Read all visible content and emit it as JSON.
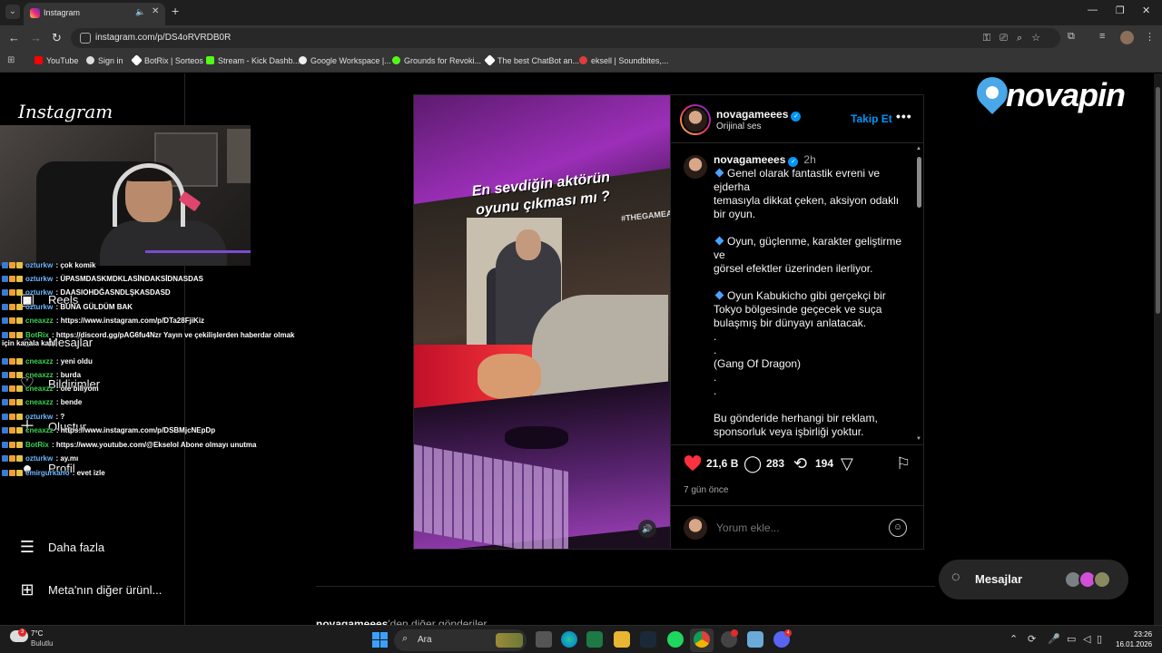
{
  "browser": {
    "tab": {
      "title": "Instagram"
    },
    "url": "instagram.com/p/DS4oRVRDB0R",
    "bookmarks": [
      "YouTube",
      "Sign in",
      "BotRix | Sorteos",
      "Stream - Kick Dashb...",
      "Google Workspace |...",
      "Grounds for Revoki...",
      "The best ChatBot an...",
      "eksell | Soundbites,..."
    ]
  },
  "sidebar": {
    "logo": "Instagram",
    "items": [
      {
        "label": "Reels",
        "icon": "reels-icon"
      },
      {
        "label": "Mesajlar",
        "icon": "messenger-icon"
      },
      {
        "label": "Bildirimler",
        "icon": "heart-icon"
      },
      {
        "label": "Oluştur",
        "icon": "plus-icon"
      },
      {
        "label": "Profil",
        "icon": "profile-icon"
      },
      {
        "label": "Daha fazla",
        "icon": "menu-icon"
      },
      {
        "label": "Meta'nın diğer ürünl...",
        "icon": "grid-icon"
      }
    ]
  },
  "stream_chat": [
    {
      "user": "ozturkw",
      "text": " : çok komik",
      "color": "#6fb7ff"
    },
    {
      "user": "ozturkw",
      "text": " : ÜPASMDASKMDKLASİNDAKSİDNASDAS",
      "color": "#6fb7ff"
    },
    {
      "user": "ozturkw",
      "text": " : DAASIOHDĞASNDLŞKASDASD",
      "color": "#6fb7ff"
    },
    {
      "user": "ozturkw",
      "text": " : BUNA GÜLDÜM BAK",
      "color": "#6fb7ff"
    },
    {
      "user": "cneaxzz",
      "text": " : https://www.instagram.com/p/DTa28FjiKiz",
      "color": "#39d353"
    },
    {
      "user": "BotRix",
      "text": " : https://discord.gg/pAG6fu4Nzr Yayın ve çekilişlerden haberdar olmak",
      "color": "#39d353"
    },
    {
      "user": "",
      "text": "için kanala katıl",
      "color": "#ffffff"
    },
    {
      "user": "cneaxzz",
      "text": " : yeni oldu",
      "color": "#39d353"
    },
    {
      "user": "cneaxzz",
      "text": " : burda",
      "color": "#39d353"
    },
    {
      "user": "cneaxzz",
      "text": " : öle biliyom",
      "color": "#39d353"
    },
    {
      "user": "cneaxzz",
      "text": " : bende",
      "color": "#39d353"
    },
    {
      "user": "ozturkw",
      "text": " : ?",
      "color": "#6fb7ff"
    },
    {
      "user": "cneaxzz",
      "text": " : https://www.instagram.com/p/DSBMjcNEpDp",
      "color": "#39d353"
    },
    {
      "user": "BotRix",
      "text": " : https://www.youtube.com/@Ekselol Abone olmayı unutma",
      "color": "#39d353"
    },
    {
      "user": "ozturkw",
      "text": " : ay.mı",
      "color": "#6fb7ff"
    },
    {
      "user": "emirgurkano",
      "text": " : evet izle",
      "color": "#6fb7ff"
    }
  ],
  "post": {
    "media": {
      "banner_line1": "En sevdiğin aktörün",
      "banner_line2": "oyunu çıkması mı ?",
      "hashtag": "#THEGAMEA"
    },
    "author": {
      "username": "novagameees",
      "subtitle": "Orijinal ses",
      "follow_label": "Takip Et"
    },
    "caption": {
      "username": "novagameees",
      "time": "2h",
      "lines": [
        {
          "text": "Genel olarak fantastik evreni ve",
          "bullet": true
        },
        {
          "text": "ejderha",
          "bullet": false
        },
        {
          "text": "temasıyla dikkat çeken, aksiyon odaklı",
          "bullet": false
        },
        {
          "text": "bir oyun.",
          "bullet": false
        },
        {
          "text": "",
          "bullet": false
        },
        {
          "text": "Oyun, güçlenme, karakter geliştirme",
          "bullet": true
        },
        {
          "text": "ve",
          "bullet": false
        },
        {
          "text": "görsel efektler üzerinden ilerliyor.",
          "bullet": false
        },
        {
          "text": "",
          "bullet": false
        },
        {
          "text": "Oyun Kabukicho gibi gerçekçi bir",
          "bullet": true
        },
        {
          "text": "Tokyo bölgesinde geçecek ve suça",
          "bullet": false
        },
        {
          "text": "bulaşmış bir dünyayı anlatacak.",
          "bullet": false
        },
        {
          "text": ".",
          "bullet": false
        },
        {
          "text": ".",
          "bullet": false
        },
        {
          "text": "(Gang Of Dragon)",
          "bullet": false
        },
        {
          "text": ".",
          "bullet": false
        },
        {
          "text": ".",
          "bullet": false
        },
        {
          "text": "",
          "bullet": false
        },
        {
          "text": "Bu gönderide herhangi bir reklam,",
          "bullet": false
        },
        {
          "text": "sponsorluk veya işbirliği yoktur.",
          "bullet": false
        }
      ]
    },
    "stats": {
      "likes": "21,6 B",
      "comments": "283",
      "reposts": "194"
    },
    "date": "7 gün önce",
    "comment_placeholder": "Yorum ekle..."
  },
  "more_posts": {
    "user": "novagameees",
    "text": "'den diğer gönderiler"
  },
  "messages_pill": {
    "label": "Mesajlar"
  },
  "overlay_logo": "novapin",
  "taskbar": {
    "weather_temp": "7°C",
    "weather_desc": "Bulutlu",
    "weather_badge": "3",
    "search_label": "Ara",
    "time": "23:26",
    "date": "16.01.2026",
    "discord_badge": "4"
  },
  "colors": {
    "accent": "#0095f6",
    "like": "#ff3040",
    "instagram_bg": "#000000"
  }
}
